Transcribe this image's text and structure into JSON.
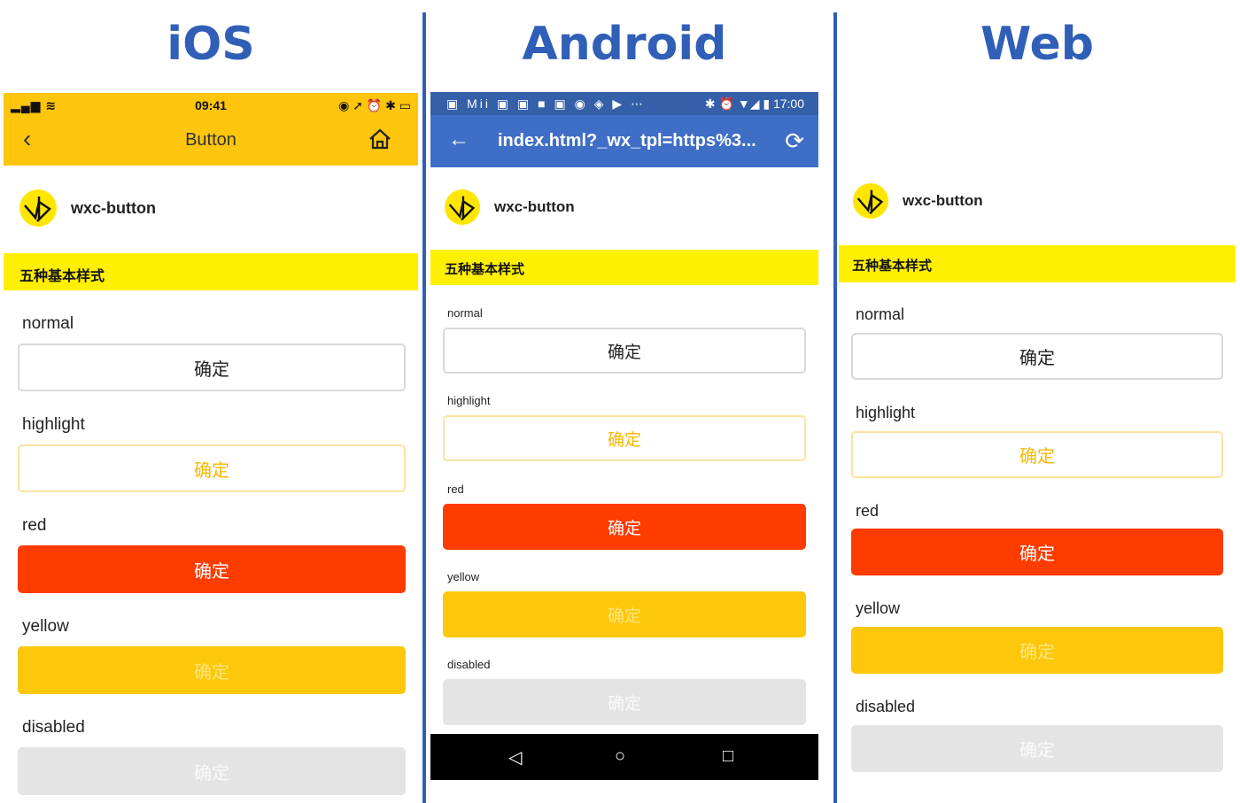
{
  "columns": {
    "ios": {
      "title": "iOS"
    },
    "android": {
      "title": "Android"
    },
    "web": {
      "title": "Web"
    }
  },
  "ios": {
    "status_time": "09:41",
    "nav_title": "Button"
  },
  "android": {
    "status_time": "17:00",
    "status_carrier": "Mii",
    "url_title": "index.html?_wx_tpl=https%3..."
  },
  "brand": {
    "name": "wxc-button"
  },
  "section_title": "五种基本样式",
  "buttons": [
    {
      "label": "normal",
      "text": "确定",
      "style": "normal"
    },
    {
      "label": "highlight",
      "text": "确定",
      "style": "highlight"
    },
    {
      "label": "red",
      "text": "确定",
      "style": "red"
    },
    {
      "label": "yellow",
      "text": "确定",
      "style": "yellow"
    },
    {
      "label": "disabled",
      "text": "确定",
      "style": "disabled"
    }
  ],
  "colors": {
    "title_blue": "#2f5fb7",
    "ios_bar": "#fdc50c",
    "android_bar": "#3f6ec6",
    "section_yellow": "#ffef00",
    "red": "#ff3c00",
    "yellow": "#fdc70c",
    "disabled": "#e4e4e4"
  }
}
